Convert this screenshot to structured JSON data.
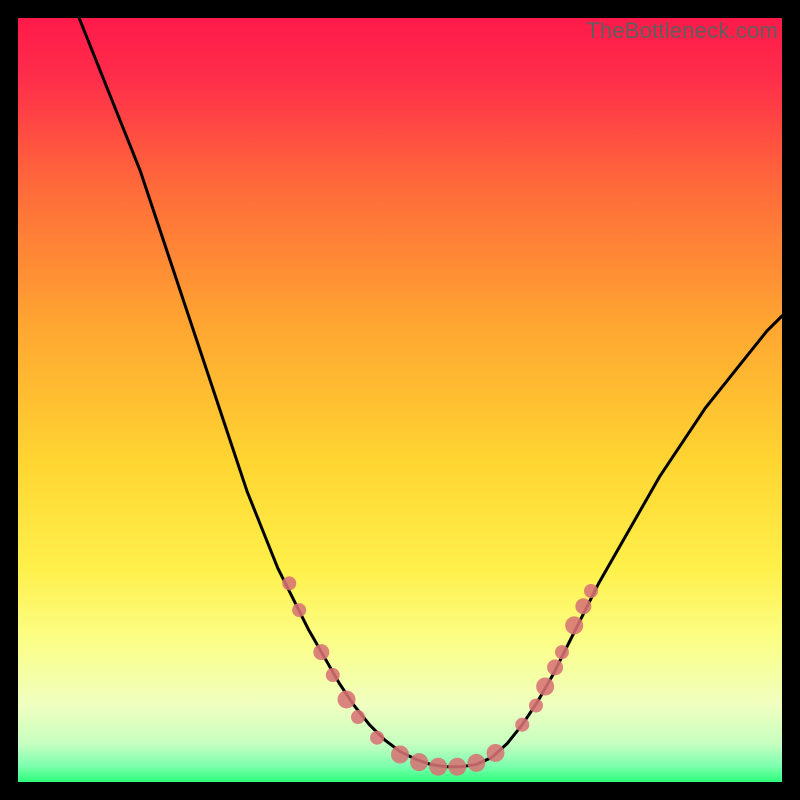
{
  "watermark": "TheBottleneck.com",
  "colors": {
    "bg": "#000000",
    "curve": "#000000",
    "marker_fill": "#d77374",
    "marker_stroke": "#d77374",
    "grad_top": "#ff1a4a",
    "grad_mid1": "#ff8a2a",
    "grad_mid2": "#ffe63a",
    "grad_mid3": "#faff8a",
    "grad_mid4": "#edffd0",
    "grad_bot": "#2cff7a"
  },
  "chart_data": {
    "type": "line",
    "title": "",
    "xlabel": "",
    "ylabel": "",
    "xlim": [
      0,
      100
    ],
    "ylim": [
      0,
      100
    ],
    "series": [
      {
        "name": "bottleneck-curve",
        "x": [
          8,
          10,
          12,
          14,
          16,
          18,
          20,
          22,
          24,
          26,
          28,
          30,
          32,
          34,
          36,
          38,
          40,
          42,
          44,
          46,
          48,
          50,
          52,
          54,
          56,
          58,
          60,
          62,
          64,
          66,
          68,
          70,
          72,
          74,
          76,
          78,
          80,
          82,
          84,
          86,
          88,
          90,
          92,
          94,
          96,
          98,
          100
        ],
        "y": [
          100,
          95,
          90,
          85,
          80,
          74,
          68,
          62,
          56,
          50,
          44,
          38,
          33,
          28,
          24,
          20,
          16.5,
          13,
          10,
          7.5,
          5.5,
          4,
          3,
          2.3,
          2,
          2,
          2.3,
          3.2,
          5,
          7.5,
          10.5,
          14,
          18,
          22,
          26,
          29.5,
          33,
          36.5,
          40,
          43,
          46,
          49,
          51.5,
          54,
          56.5,
          59,
          61
        ]
      }
    ],
    "markers": [
      {
        "x": 35.5,
        "y": 26,
        "r": 7
      },
      {
        "x": 36.8,
        "y": 22.5,
        "r": 7
      },
      {
        "x": 39.7,
        "y": 17,
        "r": 8
      },
      {
        "x": 41.2,
        "y": 14,
        "r": 7
      },
      {
        "x": 43.0,
        "y": 10.8,
        "r": 9
      },
      {
        "x": 44.5,
        "y": 8.5,
        "r": 7
      },
      {
        "x": 47.0,
        "y": 5.8,
        "r": 7
      },
      {
        "x": 50.0,
        "y": 3.6,
        "r": 9
      },
      {
        "x": 52.5,
        "y": 2.6,
        "r": 9
      },
      {
        "x": 55.0,
        "y": 2.0,
        "r": 9
      },
      {
        "x": 57.5,
        "y": 2.0,
        "r": 9
      },
      {
        "x": 60.0,
        "y": 2.5,
        "r": 9
      },
      {
        "x": 62.5,
        "y": 3.8,
        "r": 9
      },
      {
        "x": 66.0,
        "y": 7.5,
        "r": 7
      },
      {
        "x": 67.8,
        "y": 10.0,
        "r": 7
      },
      {
        "x": 69.0,
        "y": 12.5,
        "r": 9
      },
      {
        "x": 70.3,
        "y": 15.0,
        "r": 8
      },
      {
        "x": 71.2,
        "y": 17.0,
        "r": 7
      },
      {
        "x": 72.8,
        "y": 20.5,
        "r": 9
      },
      {
        "x": 74.0,
        "y": 23.0,
        "r": 8
      },
      {
        "x": 75.0,
        "y": 25.0,
        "r": 7
      }
    ]
  }
}
